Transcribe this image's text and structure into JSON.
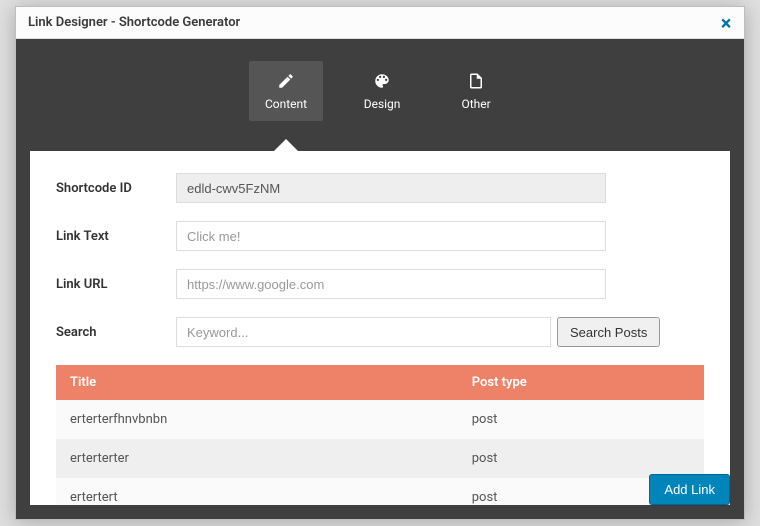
{
  "modal": {
    "title": "Link Designer - Shortcode Generator",
    "close_label": "×"
  },
  "tabs": {
    "content": "Content",
    "design": "Design",
    "other": "Other"
  },
  "form": {
    "shortcode_label": "Shortcode ID",
    "shortcode_value": "edld-cwv5FzNM",
    "linktext_label": "Link Text",
    "linktext_placeholder": "Click me!",
    "linkurl_label": "Link URL",
    "linkurl_placeholder": "https://www.google.com",
    "search_label": "Search",
    "search_placeholder": "Keyword...",
    "search_button": "Search Posts"
  },
  "table": {
    "col_title": "Title",
    "col_posttype": "Post type",
    "rows": [
      {
        "title": "erterterfhnvbnbn",
        "post_type": "post"
      },
      {
        "title": "erterterter",
        "post_type": "post"
      },
      {
        "title": "ertertert",
        "post_type": "post"
      }
    ]
  },
  "footer": {
    "add_link": "Add Link"
  }
}
